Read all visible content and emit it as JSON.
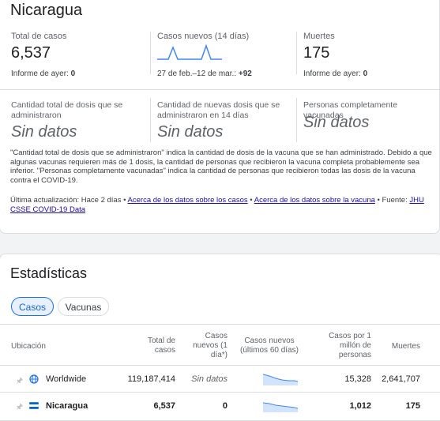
{
  "country": "Nicaragua",
  "summary": {
    "total_cases": {
      "label": "Total de casos",
      "value": "6,537",
      "foot_label": "Informe de ayer: ",
      "foot_value": "0"
    },
    "new_cases": {
      "label": "Casos nuevos (14 días)",
      "foot_label": "27 de feb.–12 de mar.: ",
      "foot_value": "+92"
    },
    "deaths": {
      "label": "Muertes",
      "value": "175",
      "foot_label": "Informe de ayer: ",
      "foot_value": "0"
    }
  },
  "vaccines": {
    "total_doses": {
      "label": "Cantidad total de dosis que se administraron",
      "value": "Sin datos"
    },
    "new_doses": {
      "label": "Cantidad de nuevas dosis que se administraron en 14 días",
      "value": "Sin datos"
    },
    "fully_vaccinated": {
      "label": "Personas completamente vacunadas",
      "value": "Sin datos"
    }
  },
  "note": "\"Cantidad total de dosis que se administraron\" indica la cantidad de dosis de la vacuna que se han administrado. Debido a que algunas vacunas requieren más de 1 dosis, la cantidad de personas que recibieron la vacuna completa probablemente sea inferior. \"Personas completamente vacunadas\" indica la cantidad de personas que recibieron todas las dosis de la vacuna contra el COVID-19.",
  "update": {
    "prefix": "Última actualización: Hace 2 días • ",
    "link_cases": "Acerca de los datos sobre los casos",
    "sep": " • ",
    "link_vaccine": "Acerca de los datos sobre la vacuna",
    "source_prefix": " • Fuente: ",
    "source_link": "JHU CSSE COVID-19 Data"
  },
  "stats": {
    "title": "Estadísticas",
    "chips": {
      "cases": "Casos",
      "vaccines": "Vacunas"
    },
    "headers": {
      "location": "Ubicación",
      "total": "Total de casos",
      "new": "Casos nuevos (1 día*)",
      "new60": "Casos nuevos (últimos 60 días)",
      "per_million": "Casos por 1 millón de personas",
      "deaths": "Muertes"
    },
    "rows": [
      {
        "name": "Worldwide",
        "total": "119,187,414",
        "new": "Sin datos",
        "per_million": "15,328",
        "deaths": "2,641,707"
      },
      {
        "name": "Nicaragua",
        "total": "6,537",
        "new": "0",
        "per_million": "1,012",
        "deaths": "175"
      }
    ]
  },
  "colors": {
    "accent": "#1a73e8",
    "sparkline": "#4285f4"
  }
}
